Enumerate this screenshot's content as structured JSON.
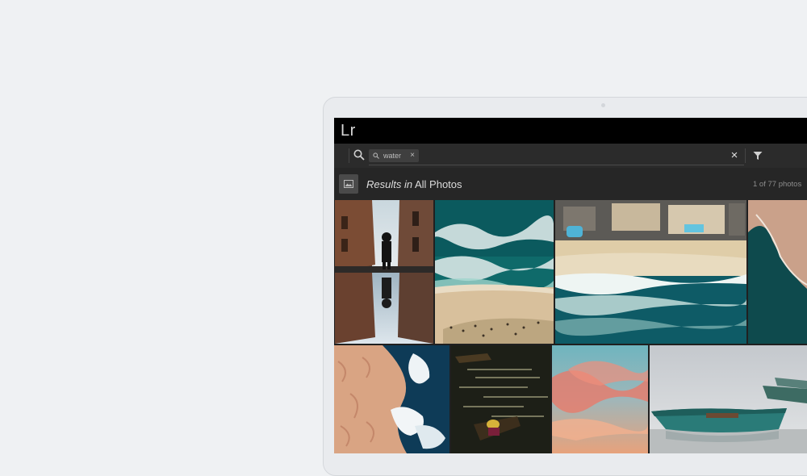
{
  "app": {
    "logo": "Lr"
  },
  "search": {
    "query_chip": "water",
    "chip_close": "×",
    "clear": "×"
  },
  "results": {
    "title_italic": "Results in",
    "title_location": "All Photos",
    "count": "1 of 77 photos"
  },
  "grid": {
    "photos": [
      {
        "name": "street-reflection"
      },
      {
        "name": "aerial-waves"
      },
      {
        "name": "aerial-resort-beach"
      },
      {
        "name": "aerial-cliff-sea"
      },
      {
        "name": "aerial-sand-lake"
      },
      {
        "name": "boat-dark-water"
      },
      {
        "name": "sunset-sky"
      },
      {
        "name": "boats-on-shore"
      }
    ]
  },
  "colors": {
    "titlebar": "#000000",
    "toolbar": "#2b2b2b",
    "panel": "#262626",
    "text": "#dcdcdc"
  }
}
